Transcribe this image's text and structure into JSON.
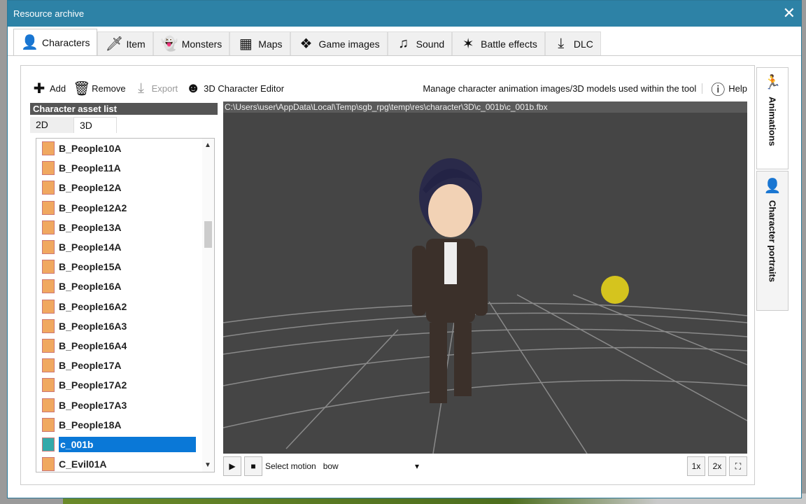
{
  "window": {
    "title": "Resource archive",
    "close": "✕"
  },
  "tabs": [
    {
      "label": "Characters",
      "icon": "character-icon",
      "g": "👤"
    },
    {
      "label": "Item",
      "icon": "sword-icon",
      "g": "🗡"
    },
    {
      "label": "Monsters",
      "icon": "ghost-icon",
      "g": "👻"
    },
    {
      "label": "Maps",
      "icon": "map-icon",
      "g": "▦"
    },
    {
      "label": "Game images",
      "icon": "box-icon",
      "g": "❖"
    },
    {
      "label": "Sound",
      "icon": "music-icon",
      "g": "♫"
    },
    {
      "label": "Battle effects",
      "icon": "effect-icon",
      "g": "✶"
    },
    {
      "label": "DLC",
      "icon": "download-icon",
      "g": "⤓"
    }
  ],
  "toolbar": {
    "add": "Add",
    "remove": "Remove",
    "export": "Export",
    "editor": "3D Character Editor",
    "description": "Manage character animation images/3D models used within the tool",
    "help": "Help"
  },
  "list": {
    "header": "Character asset list",
    "tab2d": "2D",
    "tab3d": "3D",
    "items": [
      "B_People10A",
      "B_People11A",
      "B_People12A",
      "B_People12A2",
      "B_People13A",
      "B_People14A",
      "B_People15A",
      "B_People16A",
      "B_People16A2",
      "B_People16A3",
      "B_People16A4",
      "B_People17A",
      "B_People17A2",
      "B_People17A3",
      "B_People18A",
      "c_001b",
      "C_Evil01A"
    ],
    "selected": "c_001b"
  },
  "viewer": {
    "path": "C:\\Users\\user\\AppData\\Local\\Temp\\sgb_rpg\\temp\\res\\character\\3D\\c_001b\\c_001b.fbx",
    "motion_label": "Select motion",
    "motion_value": "bow",
    "speed1": "1x",
    "speed2": "2x"
  },
  "side": {
    "animations": "Animations",
    "portraits": "Character portraits"
  }
}
